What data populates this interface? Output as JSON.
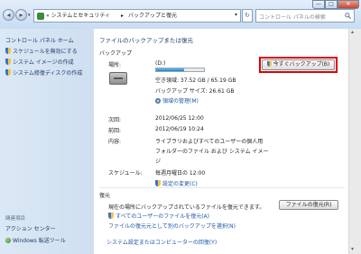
{
  "address": {
    "crumbs": [
      "« システムとセキュリティ",
      "▸",
      "バックアップと復元"
    ],
    "search_placeholder": "コントロール パネルの検索"
  },
  "window_buttons": {
    "minimize": "—",
    "maximize": "□",
    "close": "✕"
  },
  "sidebar": {
    "home": "コントロール パネル ホーム",
    "items": [
      "スケジュールを無効にする",
      "システム イメージの作成",
      "システム修復ディスクの作成"
    ],
    "see_also": "関連項目",
    "bottom_items": [
      "アクション センター",
      "Windows 転送ツール"
    ]
  },
  "main": {
    "heading": "ファイルのバックアップまたは復元",
    "backup_section": "バックアップ",
    "location_label": "場所:",
    "location_value": "(D:)",
    "disk_usage_fraction": 0.58,
    "free_space": "空き領域: 37.52 GB / 65.19 GB",
    "backup_size": "バックアップ サイズ: 26.61 GB",
    "manage_space": "領域の管理(M)",
    "backup_now_button": "今すぐバックアップ(B)",
    "next_label": "次回:",
    "next_value": "2012/06/25 12:00",
    "last_label": "前回:",
    "last_value": "2012/06/19 10:24",
    "contents_label": "内容:",
    "contents_value_1": "ライブラリおよびすべてのユーザーの個人用",
    "contents_value_2": "フォルダーのファイル および システム イメー",
    "contents_value_3": "ジ",
    "schedule_label": "スケジュール:",
    "schedule_value": "毎週月曜日の 12:00",
    "change_settings": "設定の変更(C)",
    "restore_section": "復元",
    "restore_desc": "現在の場所にバックアップされているファイルを復元できます。",
    "restore_button": "ファイルの復元(R)",
    "restore_all_users": "すべてのユーザーのファイルを復元(A)",
    "choose_other_backup": "ファイルの復元元として別のバックアップを選択(N)",
    "recover_system": "システム設定またはコンピューターの回復(Y)"
  },
  "colors": {
    "highlight": "#e00000",
    "link": "#1e56a6",
    "progress": "#1f7fc7"
  }
}
